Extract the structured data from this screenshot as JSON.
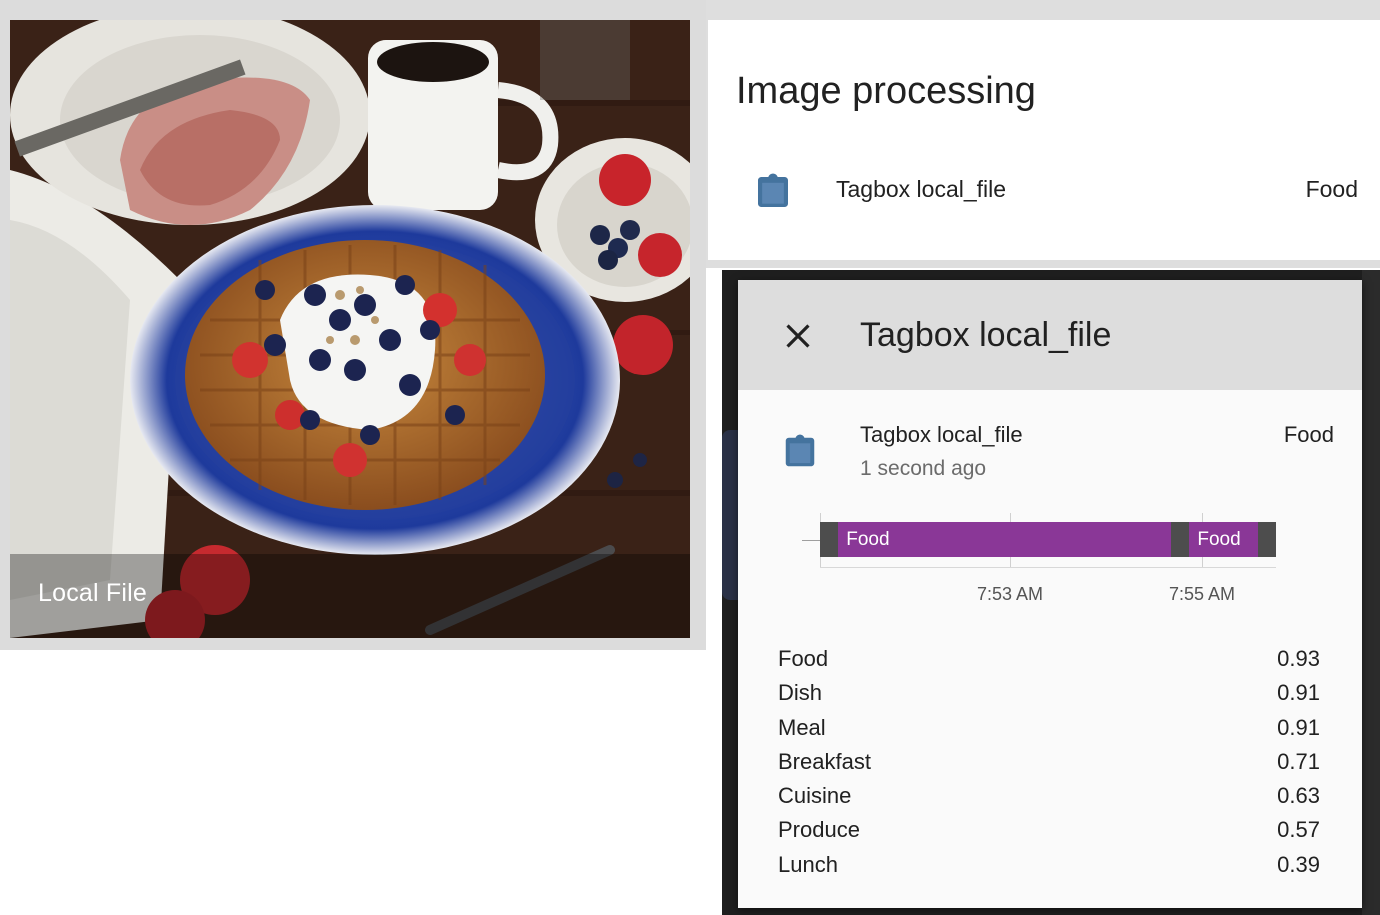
{
  "camera_card": {
    "caption": "Local File"
  },
  "entities_card": {
    "title": "Image processing",
    "row": {
      "icon": "clipboard-icon",
      "name": "Tagbox local_file",
      "state": "Food"
    }
  },
  "dialog": {
    "title": "Tagbox local_file",
    "close_icon": "close-icon",
    "entity": {
      "icon": "clipboard-icon",
      "name": "Tagbox local_file",
      "last_changed": "1 second ago",
      "state": "Food"
    },
    "timeline": {
      "segments": [
        {
          "label": "Food",
          "start": 0.04,
          "end": 0.77
        },
        {
          "label": "Food",
          "start": 0.81,
          "end": 0.96
        }
      ],
      "ticks": [
        "7:53 AM",
        "7:55 AM"
      ],
      "colors": {
        "state": "#8a3797",
        "off": "#4d4d4d"
      }
    },
    "attributes": [
      {
        "key": "Food",
        "value": "0.93"
      },
      {
        "key": "Dish",
        "value": "0.91"
      },
      {
        "key": "Meal",
        "value": "0.91"
      },
      {
        "key": "Breakfast",
        "value": "0.71"
      },
      {
        "key": "Cuisine",
        "value": "0.63"
      },
      {
        "key": "Produce",
        "value": "0.57"
      },
      {
        "key": "Lunch",
        "value": "0.39"
      }
    ]
  }
}
